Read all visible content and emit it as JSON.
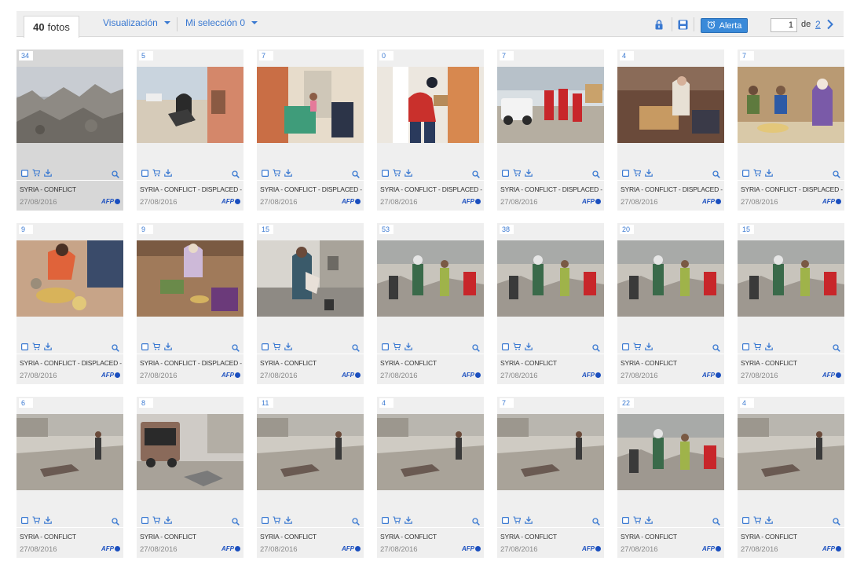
{
  "toolbar": {
    "count_number": "40",
    "count_label": "fotos",
    "view_menu": "Visualización",
    "selection_menu": "Mi selección 0",
    "alert_button": "Alerta",
    "page_current": "1",
    "page_of": "de",
    "page_total": "2"
  },
  "colors": {
    "accent": "#3a79d1",
    "alert": "#3a8ad9",
    "agency": "#1b4fbf",
    "card": "#efefef"
  },
  "cards": [
    {
      "count": "34",
      "caption": "SYRIA - CONFLICT",
      "date": "27/08/2016",
      "agency": "AFP",
      "selected": true,
      "scene": "rubble"
    },
    {
      "count": "5",
      "caption": "SYRIA - CONFLICT - DISPLACED -",
      "date": "27/08/2016",
      "agency": "AFP",
      "selected": false,
      "scene": "street"
    },
    {
      "count": "7",
      "caption": "SYRIA - CONFLICT - DISPLACED -",
      "date": "27/08/2016",
      "agency": "AFP",
      "selected": false,
      "scene": "room"
    },
    {
      "count": "0",
      "caption": "SYRIA - CONFLICT - DISPLACED -",
      "date": "27/08/2016",
      "agency": "AFP",
      "selected": false,
      "scene": "door"
    },
    {
      "count": "7",
      "caption": "SYRIA - CONFLICT - DISPLACED -",
      "date": "27/08/2016",
      "agency": "AFP",
      "selected": false,
      "scene": "truck"
    },
    {
      "count": "4",
      "caption": "SYRIA - CONFLICT - DISPLACED -",
      "date": "27/08/2016",
      "agency": "AFP",
      "selected": false,
      "scene": "indoor"
    },
    {
      "count": "7",
      "caption": "SYRIA - CONFLICT - DISPLACED -",
      "date": "27/08/2016",
      "agency": "AFP",
      "selected": false,
      "scene": "family"
    },
    {
      "count": "9",
      "caption": "SYRIA - CONFLICT - DISPLACED -",
      "date": "27/08/2016",
      "agency": "AFP",
      "selected": false,
      "scene": "meal"
    },
    {
      "count": "9",
      "caption": "SYRIA - CONFLICT - DISPLACED -",
      "date": "27/08/2016",
      "agency": "AFP",
      "selected": false,
      "scene": "meal2"
    },
    {
      "count": "15",
      "caption": "SYRIA - CONFLICT",
      "date": "27/08/2016",
      "agency": "AFP",
      "selected": false,
      "scene": "ruin"
    },
    {
      "count": "53",
      "caption": "SYRIA - CONFLICT",
      "date": "27/08/2016",
      "agency": "AFP",
      "selected": false,
      "scene": "rescue"
    },
    {
      "count": "38",
      "caption": "SYRIA - CONFLICT",
      "date": "27/08/2016",
      "agency": "AFP",
      "selected": false,
      "scene": "rescue"
    },
    {
      "count": "20",
      "caption": "SYRIA - CONFLICT",
      "date": "27/08/2016",
      "agency": "AFP",
      "selected": false,
      "scene": "rescue"
    },
    {
      "count": "15",
      "caption": "SYRIA - CONFLICT",
      "date": "27/08/2016",
      "agency": "AFP",
      "selected": false,
      "scene": "rescue"
    },
    {
      "count": "6",
      "caption": "SYRIA - CONFLICT",
      "date": "27/08/2016",
      "agency": "AFP",
      "selected": false,
      "scene": "dust"
    },
    {
      "count": "8",
      "caption": "SYRIA - CONFLICT",
      "date": "27/08/2016",
      "agency": "AFP",
      "selected": false,
      "scene": "van"
    },
    {
      "count": "11",
      "caption": "SYRIA - CONFLICT",
      "date": "27/08/2016",
      "agency": "AFP",
      "selected": false,
      "scene": "dust"
    },
    {
      "count": "4",
      "caption": "SYRIA - CONFLICT",
      "date": "27/08/2016",
      "agency": "AFP",
      "selected": false,
      "scene": "dust"
    },
    {
      "count": "7",
      "caption": "SYRIA - CONFLICT",
      "date": "27/08/2016",
      "agency": "AFP",
      "selected": false,
      "scene": "dust"
    },
    {
      "count": "22",
      "caption": "SYRIA - CONFLICT",
      "date": "27/08/2016",
      "agency": "AFP",
      "selected": false,
      "scene": "rescue"
    },
    {
      "count": "4",
      "caption": "SYRIA - CONFLICT",
      "date": "27/08/2016",
      "agency": "AFP",
      "selected": false,
      "scene": "dust"
    }
  ]
}
